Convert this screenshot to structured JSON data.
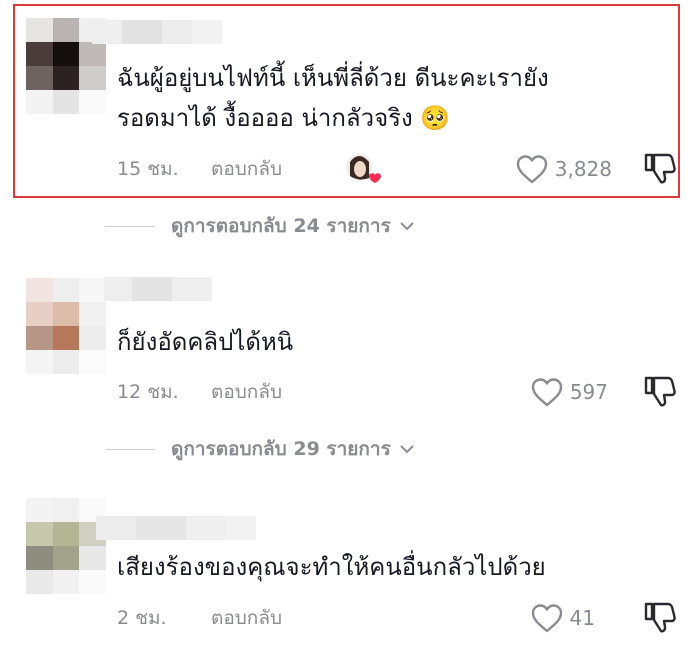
{
  "comments": [
    {
      "text_line1": "ฉันผู้อยู่บนไฟท์นี้ เห็นพี่ลี่ด้วย ดีนะคะเรายัง",
      "text_line2": "รอดมาได้ งื้ออออ น่ากลัวจริง",
      "emoji": "🥺",
      "time": "15 ชม.",
      "reply_label": "ตอบกลับ",
      "likes": "3,828",
      "liked_by_creator": true,
      "view_replies": "ดูการตอบกลับ 24 รายการ"
    },
    {
      "text_line1": "ก็ยังอัดคลิปได้หนิ",
      "time": "12 ชม.",
      "reply_label": "ตอบกลับ",
      "likes": "597",
      "view_replies": "ดูการตอบกลับ 29 รายการ"
    },
    {
      "text_line1": "เสียงร้องของคุณจะทำให้คนอื่นกลัวไปด้วย",
      "time": "2 ชม.",
      "reply_label": "ตอบกลับ",
      "likes": "41"
    }
  ],
  "colors": {
    "highlight_border": "#d93a3a",
    "secondary_text": "#8a8b91",
    "heart_fill": "#fe2c55"
  }
}
